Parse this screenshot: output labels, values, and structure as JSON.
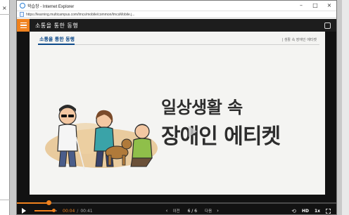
{
  "window": {
    "title": "학습창 - Internet Explorer",
    "url": "https://learning.multicampus.com/lmcs/mobile/common/lmcsMobile.j...",
    "controls": [
      "–",
      "□",
      "×"
    ]
  },
  "background_window": {
    "close_glyph": "×"
  },
  "player": {
    "course_title": "소통을 통한 동행",
    "progress_fraction": 0.1,
    "volume_fraction": 0.85
  },
  "slide": {
    "section_tag": "소통을 통한 동행",
    "breadcrumb": "| 생활 속 장애인 에티켓",
    "heading_line1": "일상생활 속",
    "heading_line2": "장애인 에티켓"
  },
  "controls": {
    "current_time": "00:04",
    "separator": "/",
    "duration": "00:41",
    "prev_arrow": "‹",
    "prev_label": "이전",
    "page_indicator": "6 / 6",
    "next_label": "다음",
    "next_arrow": "›",
    "repeat_glyph": "⟲",
    "quality": "HD",
    "speed": "1x"
  },
  "colors": {
    "accent": "#f0821e",
    "header_bg": "#1d1d1d",
    "player_bg": "#121212",
    "slide_bg": "#f4f4f2",
    "tag_blue": "#0e4a8a"
  }
}
